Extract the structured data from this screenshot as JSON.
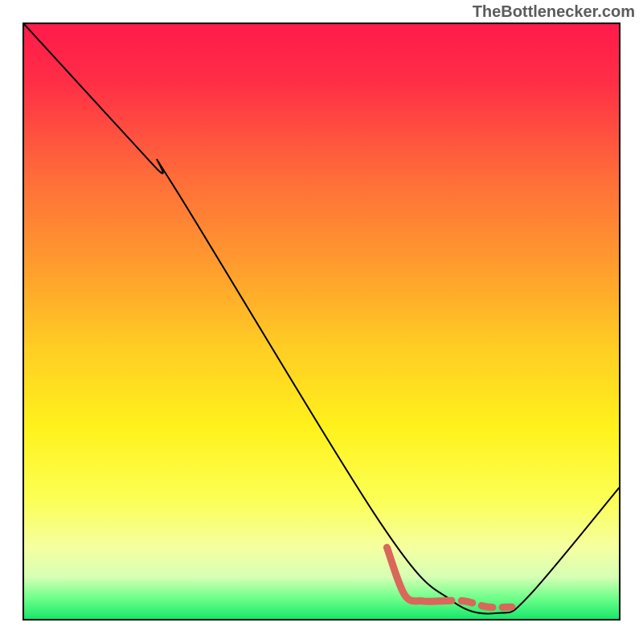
{
  "attribution": "TheBottlenecker.com",
  "chart_data": {
    "type": "line",
    "title": "",
    "xlabel": "",
    "ylabel": "",
    "xlim": [
      0,
      100
    ],
    "ylim": [
      0,
      100
    ],
    "series": [
      {
        "name": "curve-main-black",
        "stroke": "#000000",
        "stroke_width": 2,
        "dashed": false,
        "x": [
          0,
          22,
          25,
          60,
          72,
          80,
          85,
          100
        ],
        "y": [
          100,
          76,
          73,
          16,
          3,
          1,
          4,
          22
        ]
      },
      {
        "name": "curve-highlight-red",
        "stroke": "#d9675a",
        "stroke_width": 9,
        "dashed": false,
        "x": [
          61,
          64,
          67,
          70
        ],
        "y": [
          12,
          4,
          3,
          3
        ]
      },
      {
        "name": "curve-highlight-red-dashed",
        "stroke": "#d9675a",
        "stroke_width": 9,
        "dashed": true,
        "x": [
          70,
          74,
          78,
          82
        ],
        "y": [
          3,
          3,
          2,
          2
        ]
      }
    ],
    "background_gradient_stops": [
      {
        "offset": 0.0,
        "color": "#ff1a4a"
      },
      {
        "offset": 0.1,
        "color": "#ff2f46"
      },
      {
        "offset": 0.25,
        "color": "#ff6a3a"
      },
      {
        "offset": 0.4,
        "color": "#ff9a2e"
      },
      {
        "offset": 0.55,
        "color": "#ffcf23"
      },
      {
        "offset": 0.68,
        "color": "#fff21c"
      },
      {
        "offset": 0.8,
        "color": "#fcff55"
      },
      {
        "offset": 0.88,
        "color": "#f5ffa0"
      },
      {
        "offset": 0.93,
        "color": "#d5ffb4"
      },
      {
        "offset": 0.965,
        "color": "#6eff8a"
      },
      {
        "offset": 1.0,
        "color": "#18e86b"
      }
    ]
  }
}
